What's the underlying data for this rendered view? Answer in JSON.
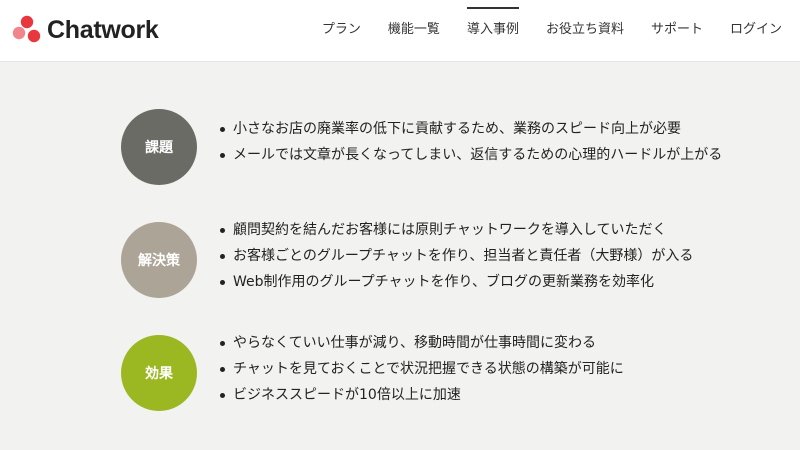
{
  "brand": {
    "name": "Chatwork"
  },
  "nav": {
    "items": [
      {
        "label": "プラン"
      },
      {
        "label": "機能一覧"
      },
      {
        "label": "導入事例"
      },
      {
        "label": "お役立ち資料"
      },
      {
        "label": "サポート"
      },
      {
        "label": "ログイン"
      }
    ],
    "active_index": 2
  },
  "colors": {
    "logo_red": "#e8383d",
    "issue": "#6b6b66",
    "solution": "#aca496",
    "effect": "#9bb823"
  },
  "sections": [
    {
      "badge": "課題",
      "items": [
        "小さなお店の廃業率の低下に貢献するため、業務のスピード向上が必要",
        "メールでは文章が長くなってしまい、返信するための心理的ハードルが上がる"
      ]
    },
    {
      "badge": "解決策",
      "items": [
        "顧問契約を結んだお客様には原則チャットワークを導入していただく",
        "お客様ごとのグループチャットを作り、担当者と責任者（大野様）が入る",
        "Web制作用のグループチャットを作り、ブログの更新業務を効率化"
      ]
    },
    {
      "badge": "効果",
      "items": [
        "やらなくていい仕事が減り、移動時間が仕事時間に変わる",
        "チャットを見ておくことで状況把握できる状態の構築が可能に",
        "ビジネススピードが10倍以上に加速"
      ]
    }
  ]
}
